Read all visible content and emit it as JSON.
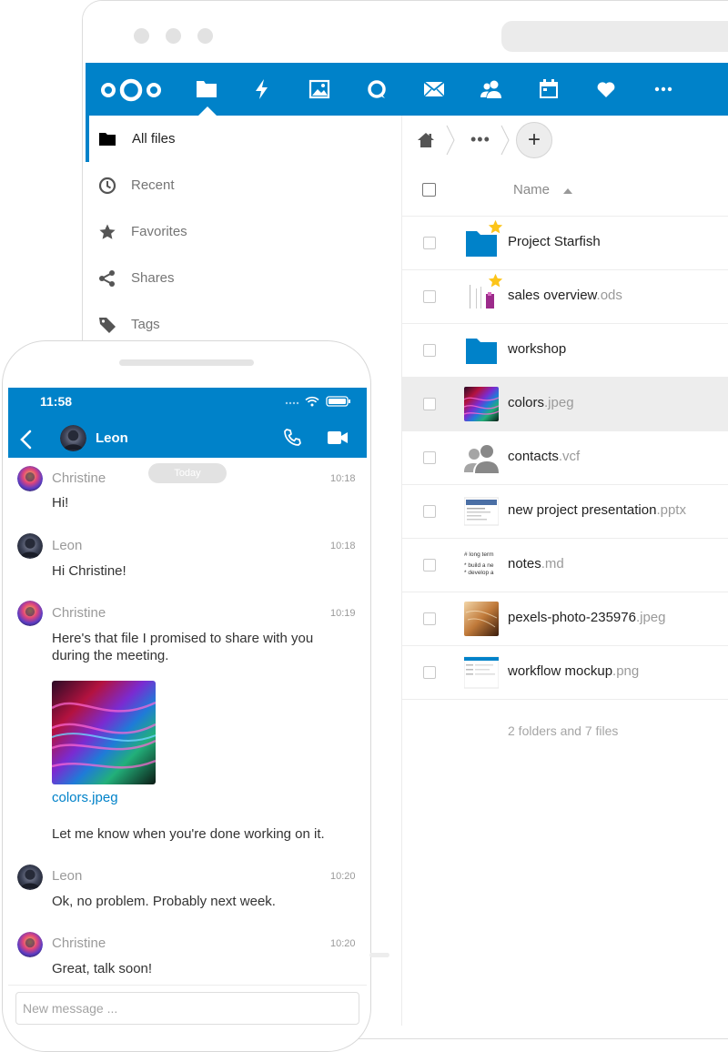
{
  "colors": {
    "brand": "#0082c9",
    "folder": "#0082c9",
    "star": "#fcc419",
    "row_selected": "#ededed"
  },
  "appbar": {
    "icons": [
      "nextcloud-logo",
      "files-icon",
      "activity-icon",
      "gallery-icon",
      "talk-icon",
      "mail-icon",
      "contacts-icon",
      "calendar-icon",
      "favorites-icon",
      "more-apps-icon"
    ]
  },
  "sidebar": {
    "items": [
      {
        "label": "All files",
        "icon": "folder-icon",
        "active": true
      },
      {
        "label": "Recent",
        "icon": "clock-icon"
      },
      {
        "label": "Favorites",
        "icon": "star-icon"
      },
      {
        "label": "Shares",
        "icon": "share-icon"
      },
      {
        "label": "Tags",
        "icon": "tag-icon"
      }
    ]
  },
  "breadcrumb": {
    "more": "•••",
    "add": "+"
  },
  "files": {
    "header": {
      "name": "Name"
    },
    "rows": [
      {
        "name": "Project Starfish",
        "ext": "",
        "type": "folder",
        "favorite": true
      },
      {
        "name": "sales overview",
        "ext": ".ods",
        "type": "spreadsheet",
        "favorite": true
      },
      {
        "name": "workshop",
        "ext": "",
        "type": "folder"
      },
      {
        "name": "colors",
        "ext": ".jpeg",
        "type": "image",
        "selected": true
      },
      {
        "name": "contacts",
        "ext": ".vcf",
        "type": "contacts"
      },
      {
        "name": "new project presentation",
        "ext": ".pptx",
        "type": "presentation"
      },
      {
        "name": "notes",
        "ext": ".md",
        "type": "text",
        "preview": [
          "# long term",
          "* build a ne",
          "* develop a"
        ]
      },
      {
        "name": "pexels-photo-235976",
        "ext": ".jpeg",
        "type": "image"
      },
      {
        "name": "workflow mockup",
        "ext": ".png",
        "type": "image"
      }
    ],
    "summary": "2 folders and 7 files"
  },
  "phone": {
    "time": "11:58",
    "contact": "Leon",
    "day_divider": "Today",
    "messages": [
      {
        "author": "Christine",
        "time": "10:18",
        "text": "Hi!"
      },
      {
        "author": "Leon",
        "time": "10:18",
        "text": "Hi Christine!"
      },
      {
        "author": "Christine",
        "time": "10:19",
        "text": "Here's that file I promised to share with you during the meeting.",
        "attachment": "colors.jpeg",
        "followup": "Let me know when you're done working on it."
      },
      {
        "author": "Leon",
        "time": "10:20",
        "text": "Ok, no problem. Probably next week."
      },
      {
        "author": "Christine",
        "time": "10:20",
        "text": "Great, talk soon!"
      }
    ],
    "composer_placeholder": "New message ..."
  }
}
